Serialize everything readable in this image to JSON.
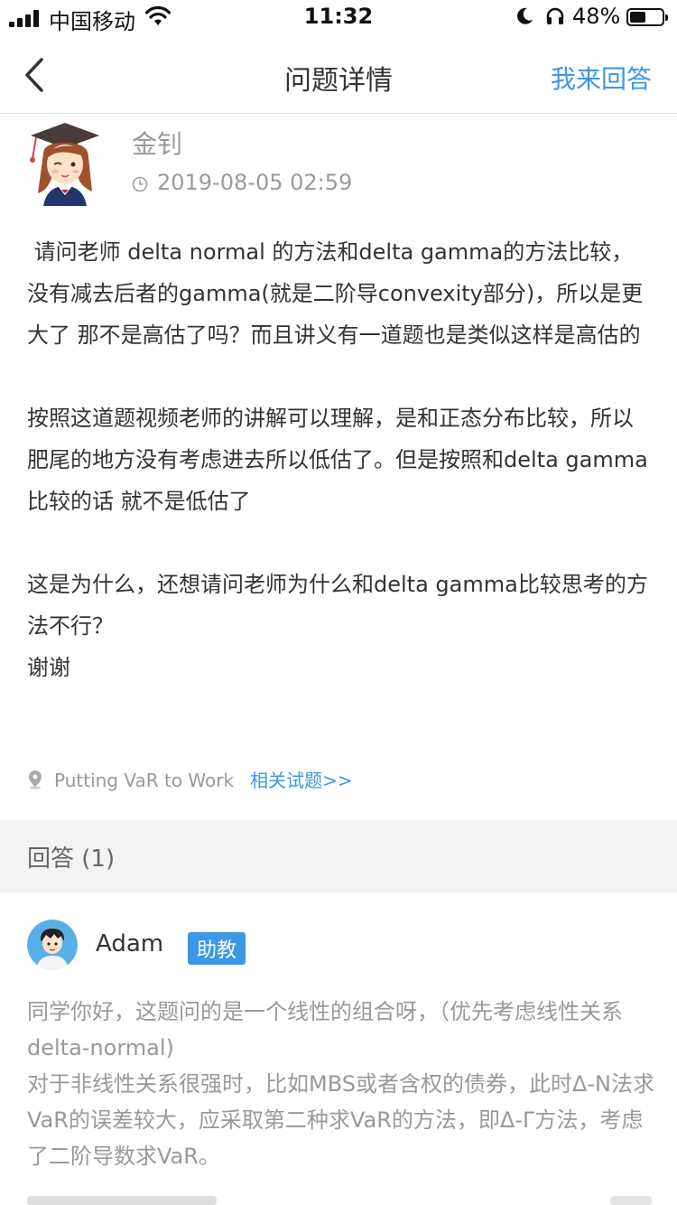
{
  "status_bar": {
    "carrier": "中国移动",
    "time": "11:32",
    "battery": "48%"
  },
  "nav": {
    "title": "问题详情",
    "answer_button": "我来回答"
  },
  "question": {
    "author": "金钊",
    "timestamp": "2019-08-05 02:59",
    "paragraphs": [
      " 请问老师 delta normal 的方法和delta gamma的方法比较，没有减去后者的gamma(就是二阶导convexity部分)，所以是更大了 那不是高估了吗？而且讲义有一道题也是类似这样是高估的",
      "按照这道题视频老师的讲解可以理解，是和正态分布比较，所以肥尾的地方没有考虑进去所以低估了。但是按照和delta gamma比较的话 就不是低估了",
      "这是为什么，还想请问老师为什么和delta gamma比较思考的方法不行？",
      "谢谢"
    ],
    "topic": "Putting VaR to Work",
    "related_link": "相关试题>>"
  },
  "answers": {
    "header": "回答 (1)",
    "items": [
      {
        "author": "Adam",
        "badge": "助教",
        "lines": [
          "同学你好，这题问的是一个线性的组合呀，（优先考虑线性关系delta-normal)",
          "对于非线性关系很强时，比如MBS或者含权的债券，此时Δ-N法求VaR的误差较大，应采取第二种求VaR的方法，即Δ-Γ方法，考虑了二阶导数求VaR。"
        ]
      }
    ]
  },
  "colors": {
    "accent": "#3c97e6",
    "muted_text": "#999999",
    "section_bg": "#f3f3f3"
  },
  "icons": [
    "signal-icon",
    "wifi-icon",
    "moon-icon",
    "headphone-icon",
    "battery-icon",
    "back-arrow-icon",
    "clock-icon",
    "location-pin-icon"
  ]
}
